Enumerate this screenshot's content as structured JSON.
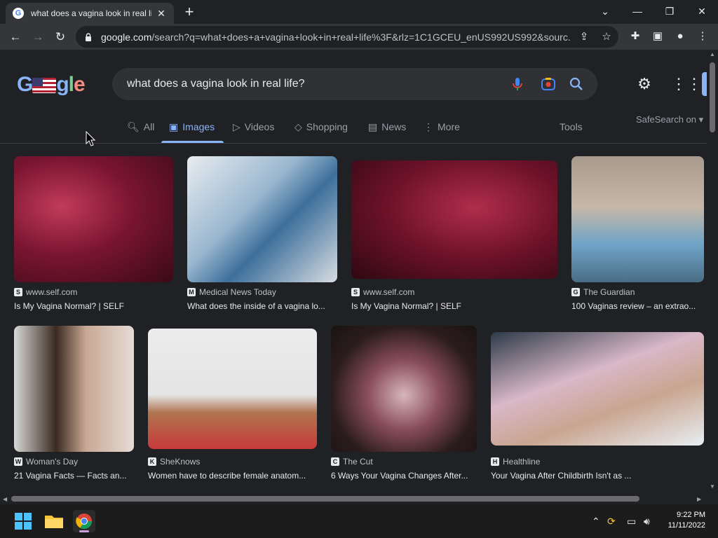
{
  "browser": {
    "tab_title": "what does a vagina look in real life?",
    "url_domain": "google.com",
    "url_rest": "/search?q=what+does+a+vagina+look+in+real+life%3F&rlz=1C1GCEU_enUS992US992&sourc..."
  },
  "search": {
    "query": "what does a vagina look in real life?"
  },
  "nav": {
    "all": "All",
    "images": "Images",
    "videos": "Videos",
    "shopping": "Shopping",
    "news": "News",
    "more": "More",
    "tools": "Tools",
    "safesearch": "SafeSearch on"
  },
  "results": [
    {
      "source": "www.self.com",
      "caption": "Is My Vagina Normal? | SELF"
    },
    {
      "source": "Medical News Today",
      "caption": "What does the inside of a vagina lo..."
    },
    {
      "source": "www.self.com",
      "caption": "Is My Vagina Normal? | SELF"
    },
    {
      "source": "The Guardian",
      "caption": "100 Vaginas review – an extrao..."
    },
    {
      "source": "Woman's Day",
      "caption": "21 Vagina Facts — Facts an..."
    },
    {
      "source": "SheKnows",
      "caption": "Women have to describe female anatom..."
    },
    {
      "source": "The Cut",
      "caption": "6 Ways Your Vagina Changes After..."
    },
    {
      "source": "Healthline",
      "caption": "Your Vagina After Childbirth Isn't as ..."
    }
  ],
  "taskbar": {
    "time": "9:22 PM",
    "date": "11/11/2022"
  },
  "colors": {
    "background": "#202124",
    "accent": "#8ab4f8",
    "searchbox": "#303134"
  }
}
